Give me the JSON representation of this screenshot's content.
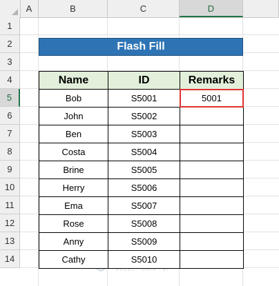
{
  "columns": [
    "A",
    "B",
    "C",
    "D"
  ],
  "selected_column": "D",
  "rows": [
    "1",
    "2",
    "3",
    "4",
    "5",
    "6",
    "7",
    "8",
    "9",
    "10",
    "11",
    "12",
    "13",
    "14"
  ],
  "selected_row": "5",
  "banner": {
    "title": "Flash Fill"
  },
  "table": {
    "headers": [
      "Name",
      "ID",
      "Remarks"
    ],
    "header_bg": "#e2efda",
    "rows": [
      {
        "name": "Bob",
        "id": "S5001",
        "remarks": "5001"
      },
      {
        "name": "John",
        "id": "S5002",
        "remarks": ""
      },
      {
        "name": "Ben",
        "id": "S5003",
        "remarks": ""
      },
      {
        "name": "Costa",
        "id": "S5004",
        "remarks": ""
      },
      {
        "name": "Brine",
        "id": "S5005",
        "remarks": ""
      },
      {
        "name": "Herry",
        "id": "S5006",
        "remarks": ""
      },
      {
        "name": "Ema",
        "id": "S5007",
        "remarks": ""
      },
      {
        "name": "Rose",
        "id": "S5008",
        "remarks": ""
      },
      {
        "name": "Anny",
        "id": "S5009",
        "remarks": ""
      },
      {
        "name": "Cathy",
        "id": "S5010",
        "remarks": ""
      }
    ]
  },
  "colors": {
    "banner": "#2e74b5",
    "active_cell_border": "#e03030",
    "selection_accent": "#217346"
  },
  "watermark": {
    "name": "exceldemy",
    "tagline": "EXCEL · DATA · BI"
  }
}
